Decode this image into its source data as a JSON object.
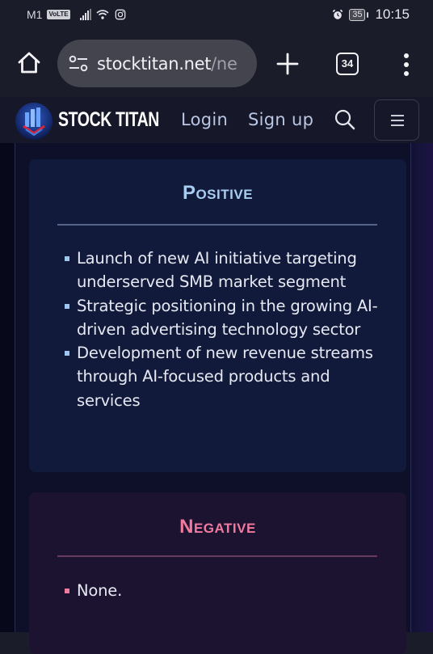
{
  "status_bar": {
    "carrier": "M1",
    "volte_label": "VoLTE",
    "battery_level": "35",
    "time": "10:15"
  },
  "browser": {
    "url_domain": "stocktitan.net",
    "url_path": "/ne",
    "tab_count": "34"
  },
  "site_header": {
    "brand": "STOCK TITAN",
    "nav": {
      "login": "Login",
      "signup": "Sign up"
    }
  },
  "colors": {
    "positive_accent": "#a9cdf0",
    "negative_accent": "#f17b9f"
  },
  "positive": {
    "title": "Positive",
    "items": [
      "Launch of new AI initiative targeting underserved SMB market segment",
      "Strategic positioning in the growing AI-driven advertising technology sector",
      "Development of new revenue streams through AI-focused products and services"
    ]
  },
  "negative": {
    "title": "Negative",
    "items": [
      "None."
    ]
  }
}
